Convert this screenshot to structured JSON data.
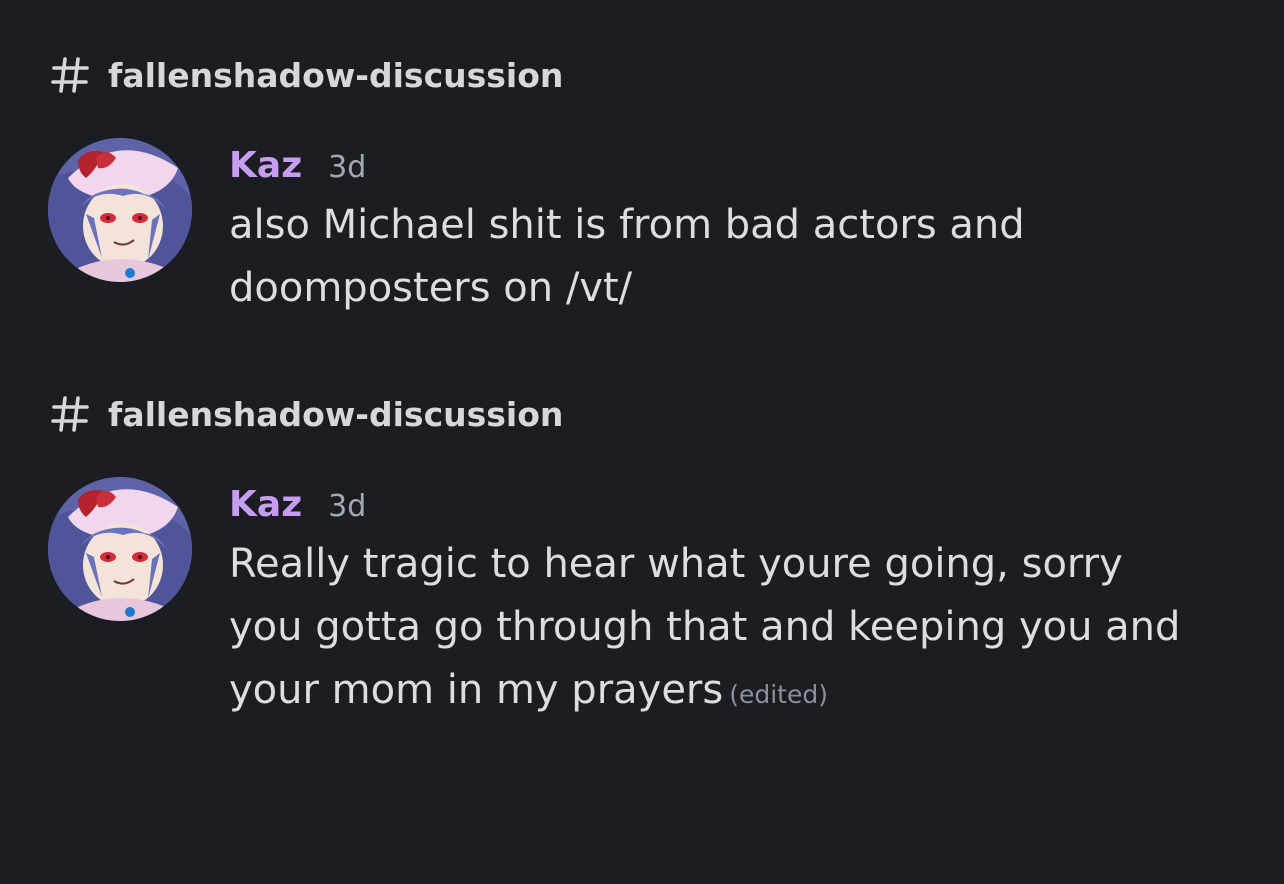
{
  "results": [
    {
      "channel": {
        "icon": "hash-icon",
        "name": "fallenshadow-discussion"
      },
      "message": {
        "avatar": "anime-character-avatar",
        "author": "Kaz",
        "author_color": "#c79df2",
        "timestamp": "3d",
        "line1": "also Michael shit is from bad actors and",
        "line2": "doomposters on /vt/",
        "line3": "",
        "edited": ""
      }
    },
    {
      "channel": {
        "icon": "hash-icon",
        "name": "fallenshadow-discussion"
      },
      "message": {
        "avatar": "anime-character-avatar",
        "author": "Kaz",
        "author_color": "#c79df2",
        "timestamp": "3d",
        "line1": "Really tragic to hear what youre going, sorry",
        "line2": "you gotta go through that and keeping you and",
        "line3": "your mom in my prayers",
        "edited": "(edited)"
      }
    }
  ],
  "theme": {
    "background": "#1c1d22",
    "text": "#dcdde1",
    "muted": "#a7a9b2"
  }
}
